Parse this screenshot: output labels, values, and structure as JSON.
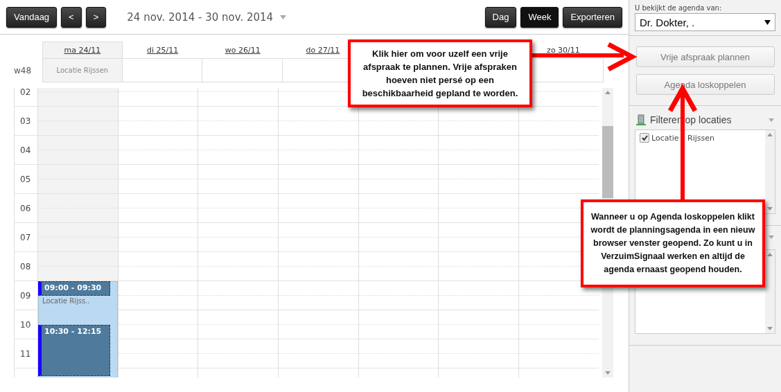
{
  "toolbar": {
    "nav_buttons": [
      {
        "label": "Vandaag"
      },
      {
        "label": "<"
      },
      {
        "label": ">"
      }
    ],
    "date_range": "24 nov. 2014 - 30 nov. 2014",
    "view_buttons": [
      {
        "label": "Dag",
        "selected": false
      },
      {
        "label": "Week",
        "selected": true
      },
      {
        "label": "Exporteren",
        "selected": false
      }
    ]
  },
  "calendar": {
    "week_label": "w48",
    "days": [
      {
        "kind": "day",
        "label": "ma 24/11",
        "selected": true,
        "location": "Locatie Rijssen",
        "availability": {
          "text": "Locatie Rijss.."
        },
        "events": [
          {
            "time": "09:00 - 09:30"
          },
          {
            "time": "10:30 - 12:15"
          }
        ]
      },
      {
        "kind": "day",
        "label": "di 25/11",
        "selected": false
      },
      {
        "kind": "day",
        "label": "wo 26/11",
        "selected": false
      },
      {
        "kind": "day",
        "label": "do 27/11",
        "selected": false
      },
      {
        "kind": "covered"
      },
      {
        "kind": "covered"
      },
      {
        "kind": "day",
        "label": "zo 30/11",
        "selected": false
      }
    ],
    "hours": [
      "02",
      "03",
      "04",
      "05",
      "06",
      "07",
      "08",
      "09",
      "10",
      "11"
    ]
  },
  "sidebar": {
    "viewer_label": "U bekijkt de agenda van:",
    "viewer_select": "Dr. Dokter, .",
    "actions": [
      {
        "label": "Vrije afspraak plannen"
      },
      {
        "label": "Agenda loskoppelen"
      }
    ],
    "filter": {
      "title": "Filteren op locaties",
      "locations": [
        {
          "label": "Locatie Rijssen",
          "checked": true
        }
      ]
    }
  },
  "callouts": [
    {
      "text": "Klik hier om voor uzelf een vrije afspraak te plannen. Vrije afspraken hoeven niet persé op een beschikbaarheid gepland te worden."
    },
    {
      "text": "Wanneer u op Agenda loskoppelen klikt wordt de planningsagenda in een nieuw browser venster geopend. Zo kunt u in VerzuimSignaal werken en altijd de agenda ernaast geopend houden."
    }
  ]
}
